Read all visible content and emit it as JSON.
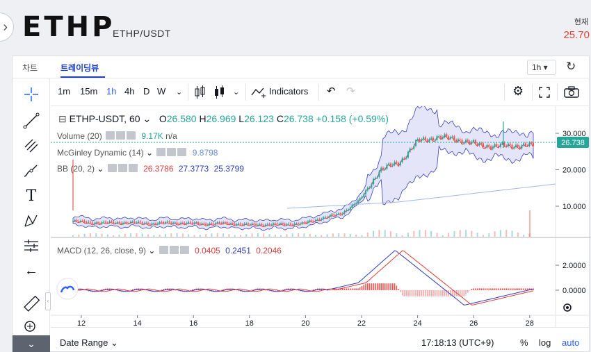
{
  "header": {
    "symbol": "ETHP",
    "pair": "ETHP/USDT",
    "price_label": "현재",
    "price_value": "25.70"
  },
  "tabs": [
    {
      "label": "차트"
    },
    {
      "label": "트레이딩뷰"
    }
  ],
  "interval_select": "1h ▾",
  "toolbar": {
    "intervals": [
      "1m",
      "15m",
      "1h",
      "4h",
      "D",
      "W"
    ],
    "active_interval": "1h",
    "indicators_label": "Indicators"
  },
  "legend": {
    "main": {
      "symbol": "ETHP-USDT, 60",
      "o": "26.580",
      "h": "26.969",
      "l": "26.123",
      "c": "26.738",
      "change": "+0.158 (+0.59%)"
    },
    "volume": {
      "label": "Volume (20)",
      "value": "9.17K",
      "na": "n/a"
    },
    "mcginley": {
      "label": "McGinley Dynamic (14)",
      "value": "9.8798"
    },
    "bb": {
      "label": "BB (20, 2)",
      "v1": "26.3786",
      "v2": "27.3773",
      "v3": "25.3799"
    },
    "macd": {
      "label": "MACD (12, 26, close, 9)",
      "v1": "0.0405",
      "v2": "0.2451",
      "v3": "0.2046"
    }
  },
  "price_axis": [
    "30.000",
    "20.000",
    "10.000"
  ],
  "price_badge": "26.738",
  "macd_axis": [
    "2.0000",
    "0.0000"
  ],
  "time_axis": [
    "12",
    "14",
    "16",
    "18",
    "20",
    "22",
    "24",
    "26",
    "28"
  ],
  "bottom": {
    "date_range": "Date Range",
    "time": "17:18:13 (UTC+9)",
    "percent": "%",
    "log": "log",
    "auto": "auto"
  },
  "colors": {
    "up": "#26a69a",
    "down": "#ef5350",
    "accent": "#2962ff",
    "price_red": "#e0433b"
  },
  "chart_data": {
    "type": "line",
    "x_ticks": [
      "12",
      "14",
      "16",
      "18",
      "20",
      "22",
      "24",
      "26",
      "28"
    ],
    "y_ticks": [
      "30.000",
      "20.000",
      "10.000"
    ],
    "series": [
      {
        "name": "ETHP-USDT, 60",
        "values": [
          6,
          5.5,
          5.5,
          5.6,
          5.3,
          5.5,
          5.4,
          5.2,
          5.4,
          5,
          5,
          5.1,
          5.3,
          6.8,
          8,
          12,
          20,
          22,
          28,
          29,
          28.5,
          27,
          26.5,
          26.7,
          26.7
        ]
      }
    ],
    "grid": false
  }
}
